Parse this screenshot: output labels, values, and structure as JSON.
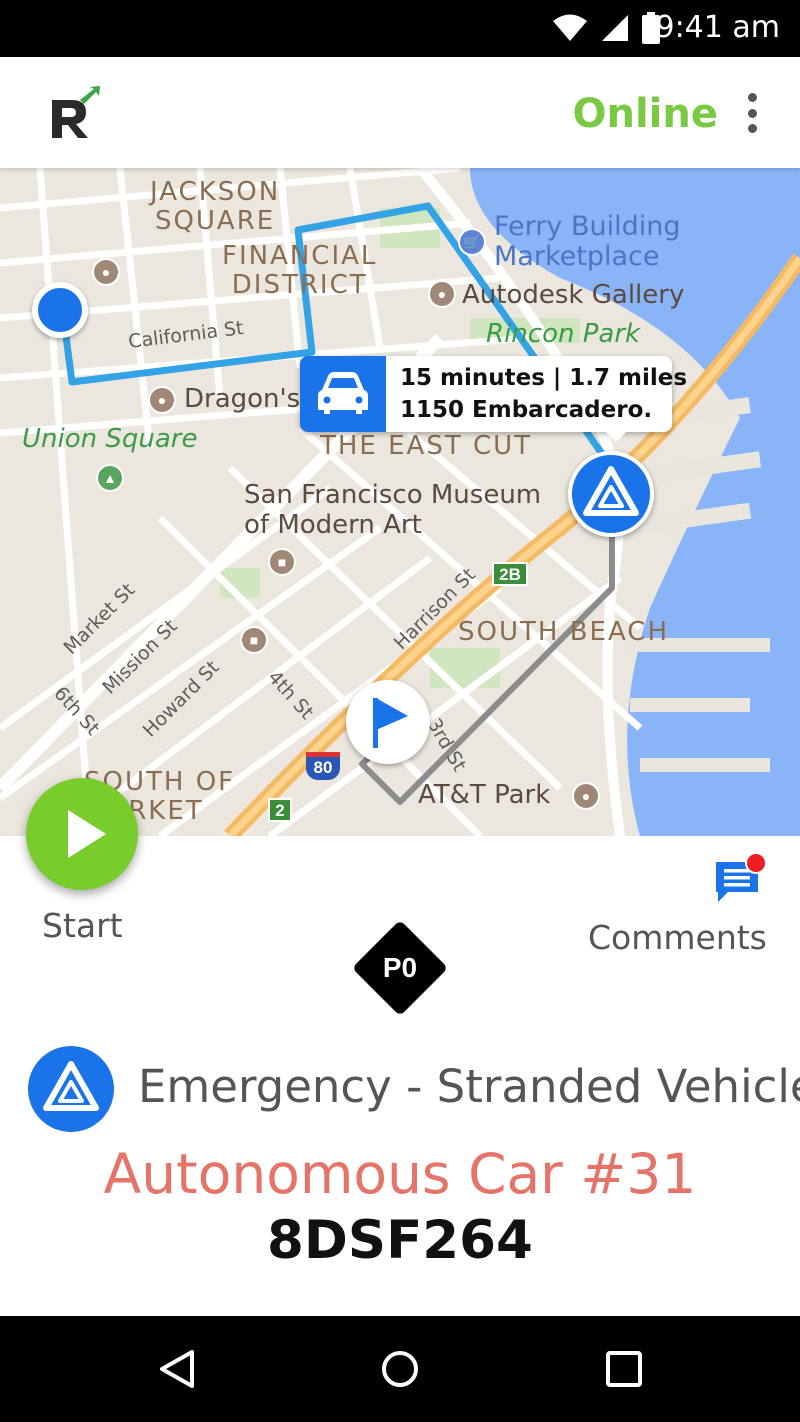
{
  "status_bar": {
    "time": "9:41 am"
  },
  "app_bar": {
    "logo_letter": "R",
    "status": "Online",
    "status_color": "#7ac943"
  },
  "map": {
    "districts": {
      "jackson_square": "JACKSON\nSQUARE",
      "financial_district": "FINANCIAL\nDISTRICT",
      "east_cut": "THE EAST CUT",
      "south_beach": "SOUTH BEACH",
      "south_of_market": "SOUTH OF\nMARKET"
    },
    "places": {
      "ferry_building": "Ferry Building\nMarketplace",
      "autodesk": "Autodesk Gallery",
      "rincon_park": "Rincon Park",
      "dragons": "Dragon's",
      "union_square": "Union Square",
      "sfmoma": "San Francisco Museum\nof Modern Art",
      "att_park": "AT&T Park"
    },
    "streets": {
      "california": "California St",
      "market": "Market St",
      "mission": "Mission St",
      "howard": "Howard St",
      "fourth": "4th St",
      "sixth": "6th St",
      "harrison": "Harrison St",
      "third": "3rd St"
    },
    "highway_shields": {
      "i80": "80",
      "exit_2b": "2B",
      "exit_2": "2"
    },
    "route_info": {
      "summary": "15 minutes | 1.7 miles",
      "address": "1150 Embarcadero."
    },
    "route_color": "#33a3e6",
    "marker_color": "#1a73e8"
  },
  "actions": {
    "start_label": "Start",
    "start_color": "#78cd2c",
    "comments_label": "Comments",
    "comments_unread": true
  },
  "incident": {
    "priority": "P0",
    "type": "Emergency - Stranded Vehicle",
    "vehicle": "Autonomous Car #31",
    "vehicle_color": "#e57368",
    "plate": "8DSF264"
  }
}
